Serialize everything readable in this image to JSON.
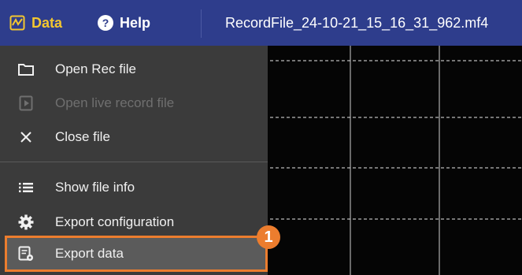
{
  "topbar": {
    "data_label": "Data",
    "help_label": "Help",
    "file_title": "RecordFile_24-10-21_15_16_31_962.mf4",
    "help_icon_text": "?"
  },
  "menu": {
    "items": [
      {
        "label": "Open Rec file",
        "icon": "folder-icon",
        "enabled": true
      },
      {
        "label": "Open live record file",
        "icon": "play-file-icon",
        "enabled": false
      },
      {
        "label": "Close file",
        "icon": "close-icon",
        "enabled": true
      },
      {
        "label": "Show file info",
        "icon": "list-icon",
        "enabled": true
      },
      {
        "label": "Export configuration",
        "icon": "gear-icon",
        "enabled": true
      },
      {
        "label": "Export data",
        "icon": "export-data-icon",
        "enabled": true,
        "highlighted": true
      }
    ]
  },
  "callout": {
    "number": "1"
  },
  "colors": {
    "topbar": "#2e3d8c",
    "data_accent": "#f2c630",
    "menu_bg": "#3b3b3b",
    "highlight": "#ec7d2e",
    "graph_bg": "#050505"
  }
}
